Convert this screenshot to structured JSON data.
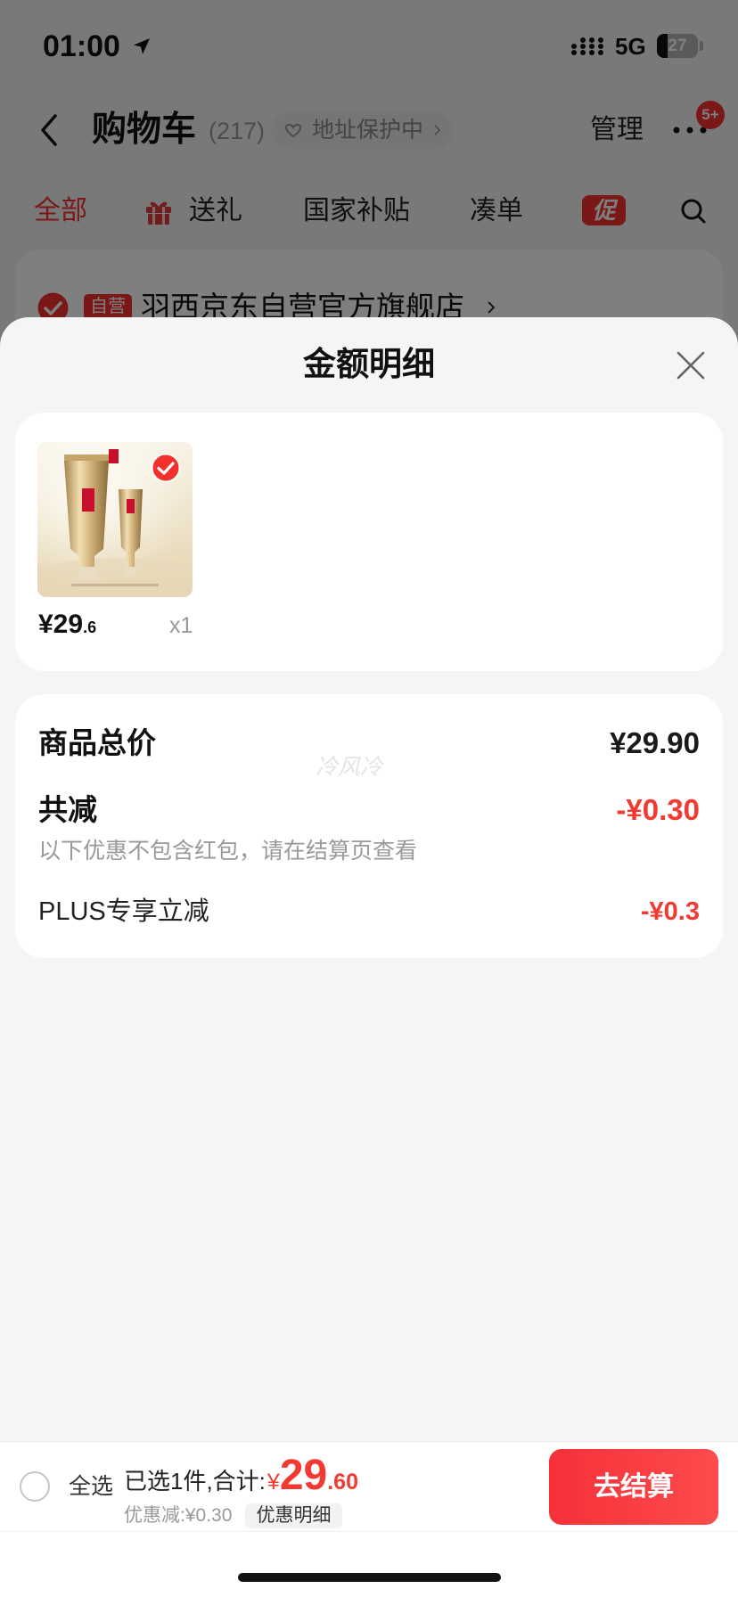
{
  "colors": {
    "accent_red": "#f2302c",
    "price_red": "#f23a32",
    "checkout_gradient_start": "#f6303a",
    "checkout_gradient_end": "#fd4b4d",
    "sheet_background": "#f5f5f5",
    "page_background": "#f2f2f2",
    "overlay": "rgba(0,0,0,0.5)"
  },
  "status_bar": {
    "time": "01:00",
    "network": "5G",
    "battery": "27",
    "battery_level": 0.27,
    "icons": [
      "location-arrow-icon",
      "signal-icon",
      "battery-icon"
    ]
  },
  "nav": {
    "title": "购物车",
    "count": "(217)",
    "address_protect": "地址保护中",
    "manage": "管理",
    "more_badge": "5+",
    "icons": [
      "back-chevron-icon",
      "address-protect-icon",
      "chevron-right-icon",
      "more-icon"
    ]
  },
  "tabs": [
    {
      "label": "全部",
      "active": true
    },
    {
      "label": "送礼",
      "icon": "gift-icon"
    },
    {
      "label": "国家补贴"
    },
    {
      "label": "凑单"
    },
    {
      "label": "促",
      "badge": true
    }
  ],
  "tabs_trailing_icon": "search-icon",
  "shop": {
    "badge": "自营",
    "name": "羽西京东自营官方旗舰店",
    "selected": true
  },
  "sheet": {
    "title": "金额明细",
    "close_icon": "close-icon",
    "products": [
      {
        "price_int": "¥29",
        "price_dec": ".6",
        "qty": "x1",
        "selected": true
      }
    ],
    "summary": {
      "total_label": "商品总价",
      "total_value": "¥29.90",
      "discount_label": "共减",
      "discount_value": "-¥0.30",
      "discount_note": "以下优惠不包含红包，请在结算页查看",
      "discount_items": [
        {
          "label": "PLUS专享立减",
          "value": "-¥0.3"
        }
      ]
    },
    "watermark": "冷风冷"
  },
  "footer": {
    "select_all": "全选",
    "all_selected": false,
    "selected_summary": "已选1件,合计:",
    "total_currency": "¥",
    "total_int": "29",
    "total_dec": ".60",
    "discount_summary": "优惠减:¥0.30",
    "discount_detail": "优惠明细",
    "checkout": "去结算"
  }
}
